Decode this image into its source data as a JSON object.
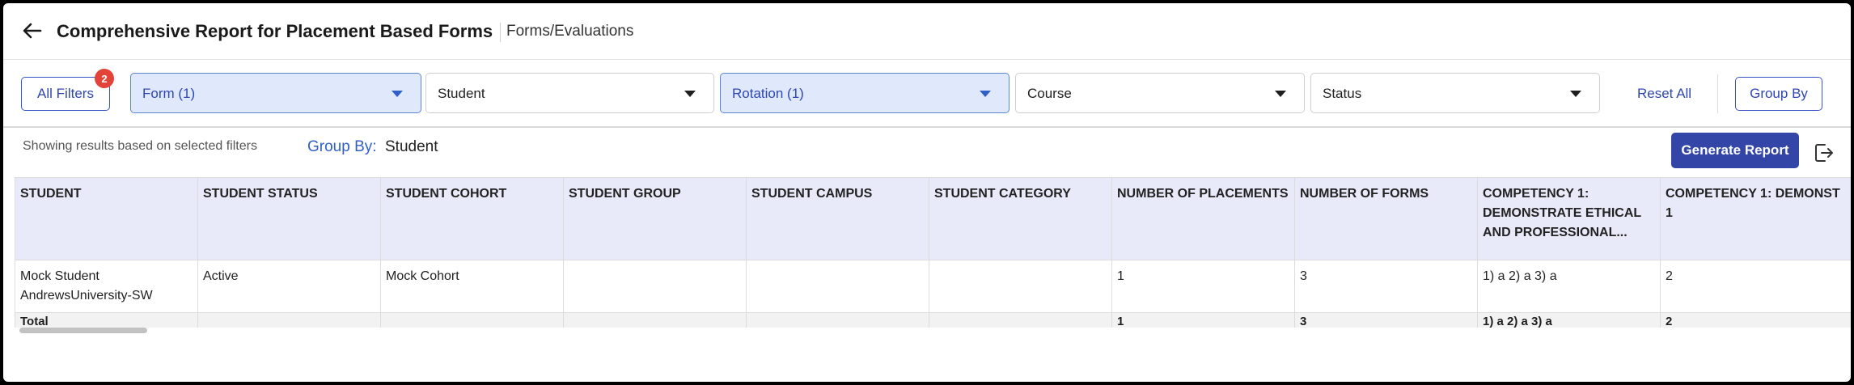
{
  "header": {
    "title": "Comprehensive Report for Placement Based Forms",
    "breadcrumb": "Forms/Evaluations",
    "back_icon": "arrow-left-icon"
  },
  "filters": {
    "all_filters_label": "All Filters",
    "all_filters_badge": "2",
    "selects": [
      {
        "label": "Form (1)",
        "active": true
      },
      {
        "label": "Student",
        "active": false
      },
      {
        "label": "Rotation (1)",
        "active": true
      },
      {
        "label": "Course",
        "active": false
      },
      {
        "label": "Status",
        "active": false
      }
    ],
    "reset_all_label": "Reset All",
    "group_by_label": "Group By"
  },
  "results": {
    "showing_text": "Showing results based on selected filters",
    "group_by_label": "Group By:",
    "group_by_value": "Student",
    "generate_report_label": "Generate Report",
    "export_icon": "export-icon"
  },
  "table": {
    "columns": [
      "STUDENT",
      "STUDENT STATUS",
      "STUDENT COHORT",
      "STUDENT GROUP",
      "STUDENT CAMPUS",
      "STUDENT CATEGORY",
      "NUMBER OF PLACEMENTS",
      "NUMBER OF FORMS",
      "COMPETENCY 1: DEMONSTRATE ETHICAL AND PROFESSIONAL...",
      "COMPETENCY 1: DEMONST 1"
    ],
    "rows": [
      [
        "Mock Student AndrewsUniversity-SW",
        "Active",
        "Mock Cohort",
        "",
        "",
        "",
        "1",
        "3",
        "1) a 2) a 3) a",
        "2"
      ]
    ],
    "total": [
      "Total",
      "",
      "",
      "",
      "",
      "",
      "1",
      "3",
      "1) a 2) a 3) a",
      "2"
    ]
  },
  "colors": {
    "accent": "#3345a6",
    "link": "#2f47b0",
    "active_select_bg": "#dfe9fb",
    "badge": "#e2443a",
    "header_row_bg": "#e9eaf9"
  }
}
